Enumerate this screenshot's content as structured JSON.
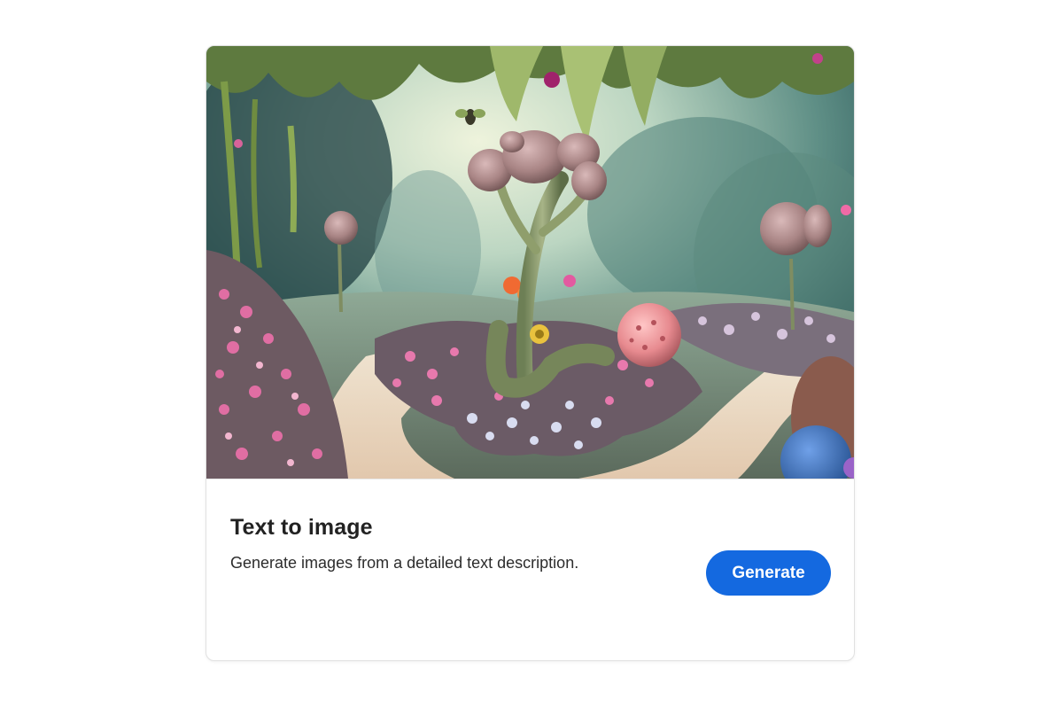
{
  "card": {
    "title": "Text to image",
    "description": "Generate images from a detailed text description.",
    "generate_label": "Generate"
  },
  "colors": {
    "button_bg": "#1469e0",
    "button_text": "#ffffff",
    "title_text": "#222222"
  },
  "icons": {
    "hero": "fantasy-garden-illustration"
  }
}
